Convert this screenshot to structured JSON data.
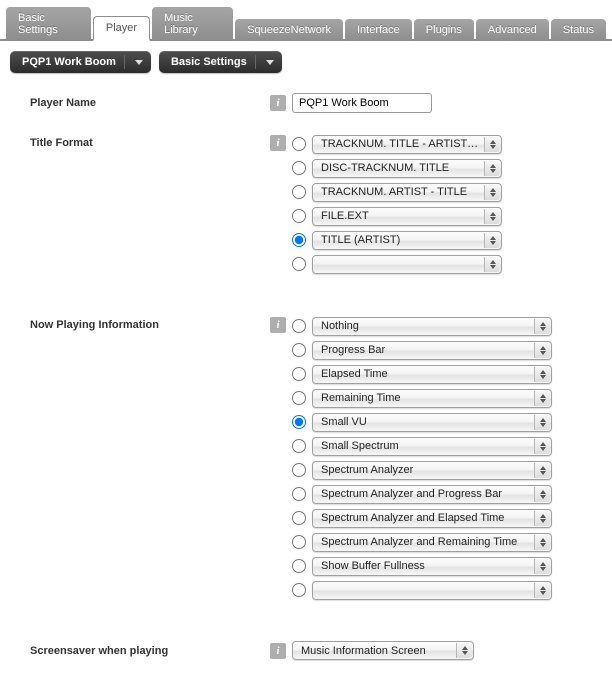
{
  "tabs": [
    {
      "label": "Basic Settings",
      "active": false
    },
    {
      "label": "Player",
      "active": true
    },
    {
      "label": "Music Library",
      "active": false
    },
    {
      "label": "SqueezeNetwork",
      "active": false
    },
    {
      "label": "Interface",
      "active": false
    },
    {
      "label": "Plugins",
      "active": false
    },
    {
      "label": "Advanced",
      "active": false
    },
    {
      "label": "Status",
      "active": false
    }
  ],
  "pills": {
    "player": "PQP1 Work Boom",
    "section": "Basic Settings"
  },
  "playerName": {
    "label": "Player Name",
    "value": "PQP1 Work Boom"
  },
  "titleFormat": {
    "label": "Title Format",
    "options": [
      {
        "text": "TRACKNUM. TITLE - ARTIST - ALBUM",
        "selected": false
      },
      {
        "text": "DISC-TRACKNUM. TITLE",
        "selected": false
      },
      {
        "text": "TRACKNUM. ARTIST - TITLE",
        "selected": false
      },
      {
        "text": "FILE.EXT",
        "selected": false
      },
      {
        "text": "TITLE (ARTIST)",
        "selected": true
      },
      {
        "text": "",
        "selected": false
      }
    ]
  },
  "nowPlaying": {
    "label": "Now Playing Information",
    "options": [
      {
        "text": "Nothing",
        "selected": false
      },
      {
        "text": "Progress Bar",
        "selected": false
      },
      {
        "text": "Elapsed Time",
        "selected": false
      },
      {
        "text": "Remaining Time",
        "selected": false
      },
      {
        "text": "Small VU",
        "selected": true
      },
      {
        "text": "Small Spectrum",
        "selected": false
      },
      {
        "text": "Spectrum Analyzer",
        "selected": false
      },
      {
        "text": "Spectrum Analyzer and Progress Bar",
        "selected": false
      },
      {
        "text": "Spectrum Analyzer and Elapsed Time",
        "selected": false
      },
      {
        "text": "Spectrum Analyzer and Remaining Time",
        "selected": false
      },
      {
        "text": "Show Buffer Fullness",
        "selected": false
      },
      {
        "text": "",
        "selected": false
      }
    ]
  },
  "screensaver": {
    "label": "Screensaver when playing",
    "value": "Music Information Screen"
  }
}
